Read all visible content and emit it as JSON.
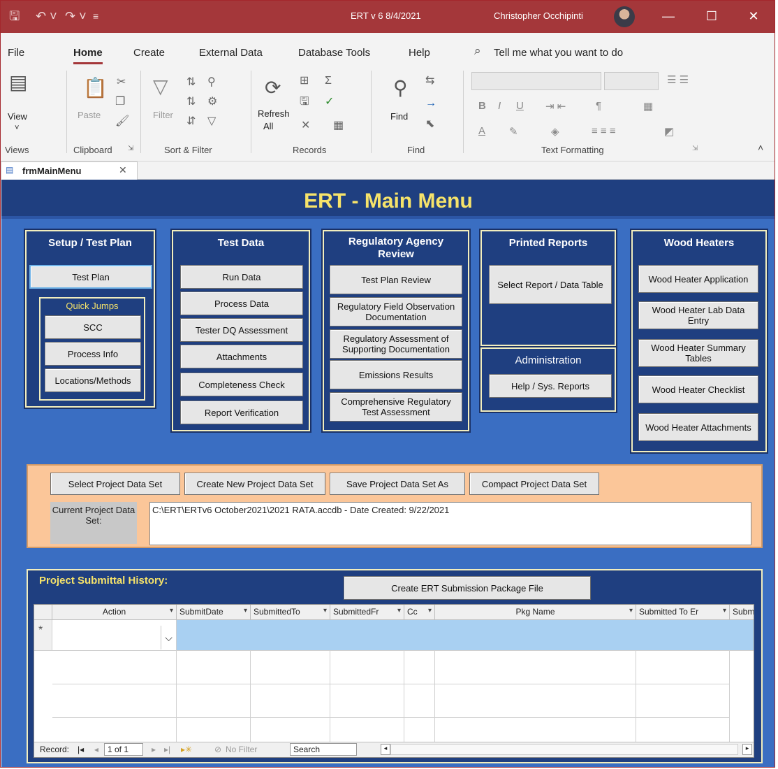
{
  "titlebar": {
    "save_icon": "save-icon",
    "title": "ERT v 6  8/4/2021",
    "user": "Christopher Occhipinti",
    "bg_color": "#a4373a"
  },
  "menu": {
    "items": [
      "File",
      "Home",
      "Create",
      "External Data",
      "Database Tools",
      "Help"
    ],
    "active": "Home",
    "tell_me": "Tell me what you want to do"
  },
  "ribbon": {
    "view_label": "View",
    "paste_label": "Paste",
    "filter_label": "Filter",
    "refresh_label": "Refresh",
    "refresh_all": "All",
    "find_label": "Find",
    "groups": [
      "Views",
      "Clipboard",
      "Sort & Filter",
      "Records",
      "Find",
      "Text Formatting"
    ]
  },
  "doc_tab": {
    "label": "frmMainMenu"
  },
  "form": {
    "title": "ERT - Main Menu",
    "title_color": "#f6e36a",
    "panels": {
      "setup": {
        "title": "Setup / Test Plan",
        "test_plan": "Test Plan",
        "quick_jumps": "Quick Jumps",
        "scc": "SCC",
        "process_info": "Process Info",
        "locations": "Locations/Methods"
      },
      "testdata": {
        "title": "Test Data",
        "buttons": [
          "Run Data",
          "Process Data",
          "Tester DQ Assessment",
          "Attachments",
          "Completeness Check",
          "Report Verification"
        ]
      },
      "regulatory": {
        "title": "Regulatory Agency Review",
        "buttons": [
          "Test Plan Review",
          "Regulatory Field Observation Documentation",
          "Regulatory Assessment of Supporting Documentation",
          "Emissions Results",
          "Comprehensive Regulatory Test Assessment"
        ]
      },
      "printed": {
        "title": "Printed Reports",
        "select": "Select Report / Data Table"
      },
      "admin": {
        "title": "Administration",
        "help": "Help / Sys. Reports"
      },
      "wood": {
        "title": "Wood Heaters",
        "buttons": [
          "Wood Heater Application",
          "Wood Heater Lab Data Entry",
          "Wood Heater Summary Tables",
          "Wood Heater Checklist",
          "Wood Heater Attachments"
        ]
      }
    },
    "project": {
      "buttons": [
        "Select Project Data Set",
        "Create New Project Data Set",
        "Save Project Data Set As",
        "Compact Project Data Set"
      ],
      "current_label": "Current Project Data Set:",
      "current_value": "C:\\ERT\\ERTv6 October2021\\2021 RATA.accdb - Date Created: 9/22/2021"
    },
    "history": {
      "title": "Project Submittal History:",
      "create_btn": "Create ERT Submission Package File",
      "columns": [
        "Action",
        "SubmitDate",
        "SubmittedTo",
        "SubmittedFr",
        "Cc",
        "Pkg Name",
        "Submitted To Er",
        "Submit"
      ],
      "new_row_marker": "*",
      "nav": {
        "record_label": "Record:",
        "position": "1 of 1",
        "no_filter": "No Filter",
        "search": "Search"
      }
    }
  }
}
